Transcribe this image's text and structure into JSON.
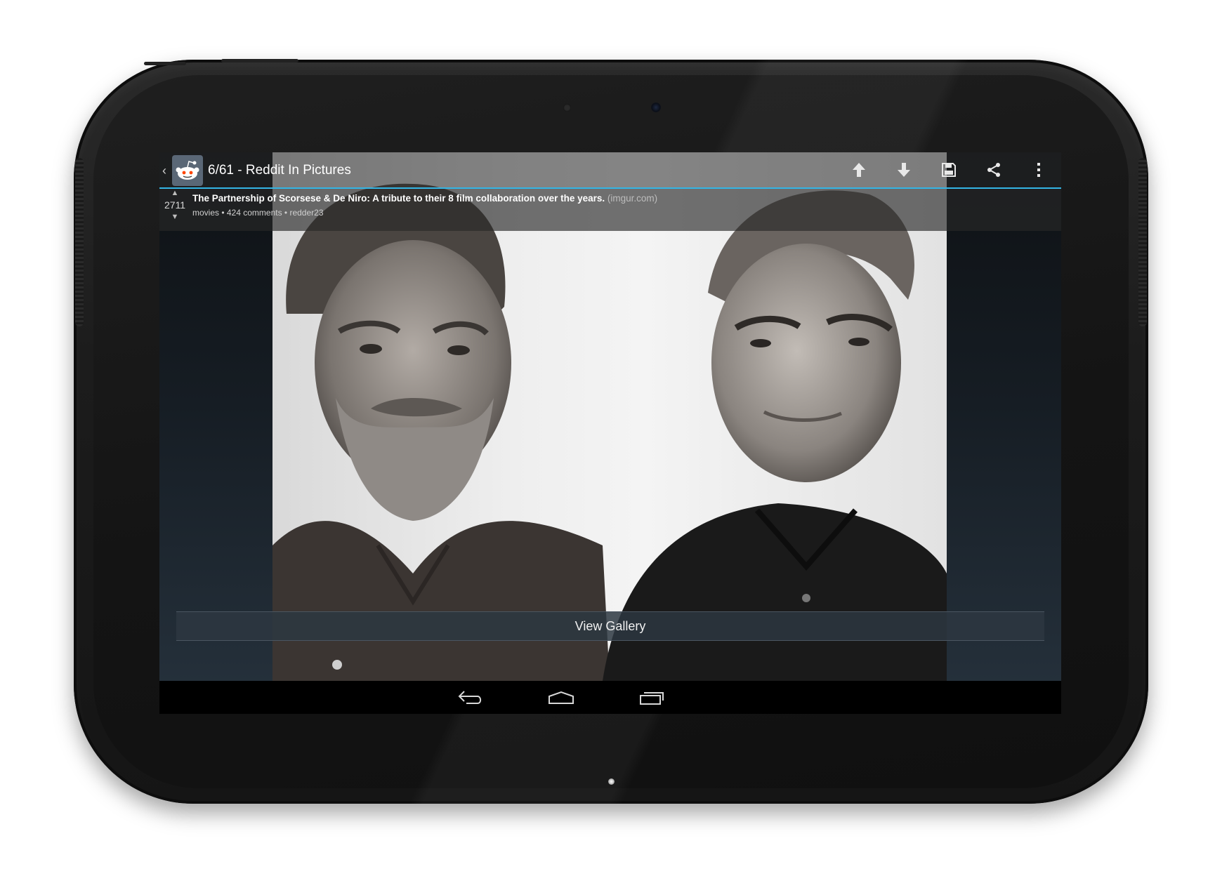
{
  "action_bar": {
    "title": "6/61 - Reddit In Pictures",
    "actions": [
      "upvote-icon",
      "downvote-icon",
      "save-icon",
      "share-icon",
      "overflow-menu-icon"
    ]
  },
  "post": {
    "score": "2711",
    "title": "The Partnership of Scorsese & De Niro: A tribute to their 8 film collaboration over the years.",
    "domain": "(imgur.com)",
    "meta": "movies • 424 comments • redder23"
  },
  "gallery": {
    "label": "View Gallery"
  },
  "navigation": [
    "back-icon",
    "home-icon",
    "recent-apps-icon"
  ],
  "colors": {
    "accent": "#33b5e5",
    "nav_bar": "#000000"
  }
}
